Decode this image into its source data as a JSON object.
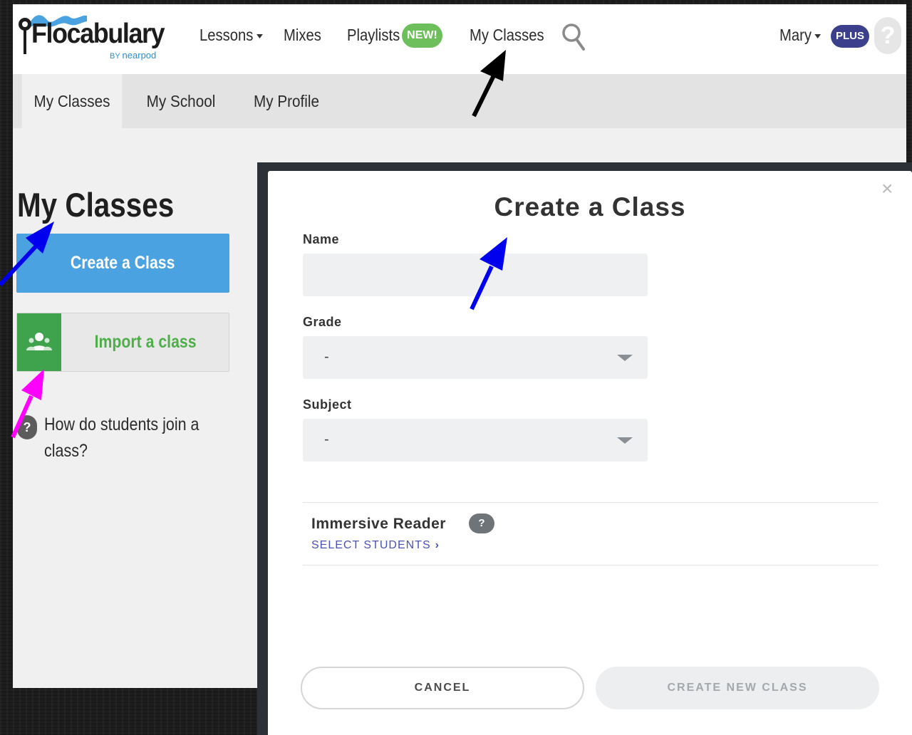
{
  "colors": {
    "primary_blue": "#4aa3e0",
    "import_green": "#3fa34d",
    "new_badge": "#6cbf5a",
    "plus_badge": "#3c3f8c",
    "link": "#4a51b8",
    "arrow_black": "#000000",
    "arrow_blue": "#0000ee",
    "arrow_magenta": "#ff00ff"
  },
  "logo": {
    "name": "Flocabulary",
    "by": "BY",
    "partner": "nearpod"
  },
  "topnav": {
    "lessons": "Lessons",
    "mixes": "Mixes",
    "playlists": "Playlists",
    "new_badge": "NEW!",
    "my_classes": "My Classes",
    "search_icon": "search-icon",
    "user": "Mary",
    "plus_badge": "PLUS",
    "help": "?"
  },
  "subnav": {
    "tabs": [
      {
        "label": "My Classes",
        "active": true
      },
      {
        "label": "My School",
        "active": false
      },
      {
        "label": "My Profile",
        "active": false
      }
    ]
  },
  "sidebar": {
    "heading": "My Classes",
    "create_button": "Create a Class",
    "import_button": "Import a class",
    "import_icon": "google-classroom-icon",
    "help_q": "?",
    "help_text": "How do students join a class?"
  },
  "modal": {
    "title": "Create a Class",
    "close": "×",
    "name_label": "Name",
    "name_value": "",
    "grade_label": "Grade",
    "grade_value": "-",
    "subject_label": "Subject",
    "subject_value": "-",
    "immersive_reader": "Immersive Reader",
    "immersive_help": "?",
    "select_students": "SELECT STUDENTS",
    "cancel": "CANCEL",
    "submit": "CREATE NEW CLASS"
  }
}
